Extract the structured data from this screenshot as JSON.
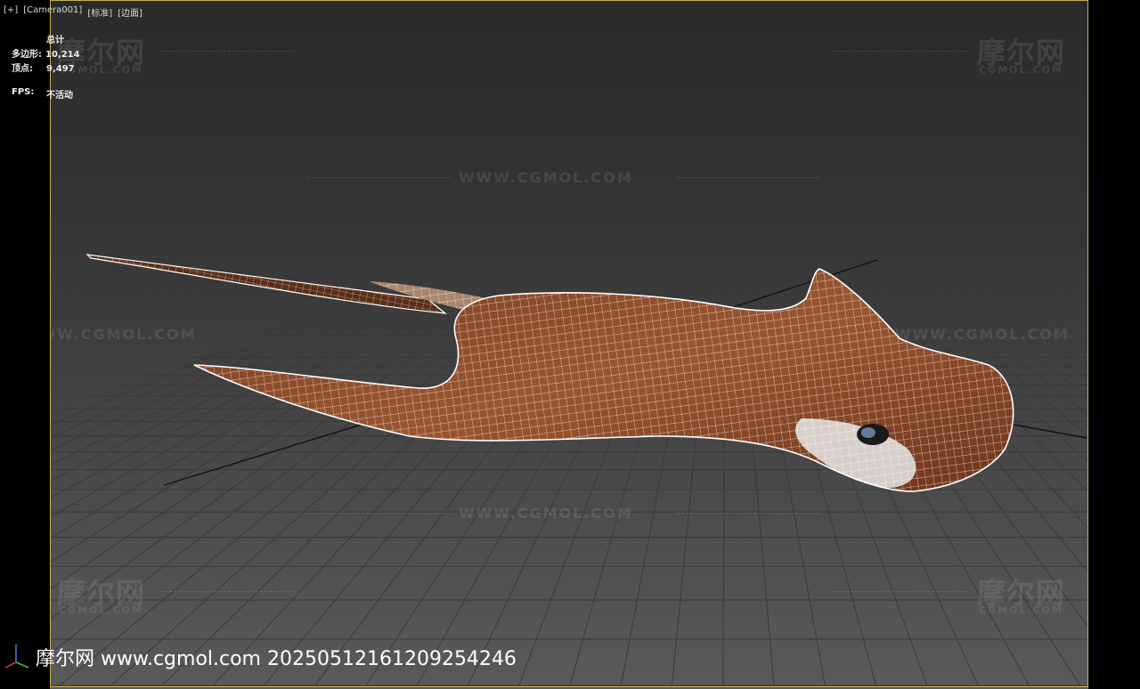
{
  "viewport": {
    "labels": [
      "[+]",
      "[Camera001]",
      "[标准]",
      "[边面]"
    ]
  },
  "stats": {
    "total_label": "总计",
    "polygons_label": "多边形:",
    "polygons_value": "10,214",
    "vertices_label": "顶点:",
    "vertices_value": "9,497",
    "fps_label": "FPS:",
    "fps_value": "不活动"
  },
  "watermarks": {
    "url": "WWW.CGMOL.COM",
    "brand": "摩尔网",
    "brand_sub": "CGMOL.COM"
  },
  "footer": {
    "text": "摩尔网 www.cgmol.com 20250512161209254246"
  },
  "colors": {
    "model_fill": "#8a4b2a",
    "wire": "#ffffff",
    "frame": "#c9b24a"
  },
  "icons": {
    "axis_gizmo": "xyz-axis-icon"
  }
}
